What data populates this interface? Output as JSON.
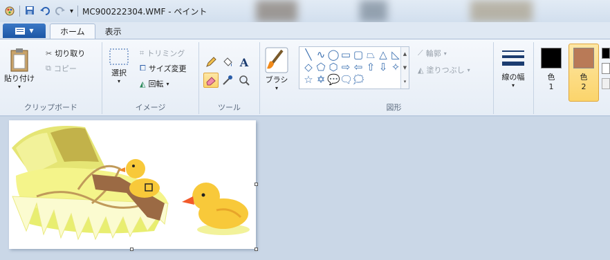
{
  "window": {
    "title": "MC900222304.WMF - ペイント"
  },
  "quick_access": {
    "icons": [
      "paint-app-icon",
      "save-icon",
      "undo-icon",
      "redo-icon",
      "customize-dropdown-icon"
    ]
  },
  "menu": {
    "file_label": "",
    "tabs": [
      {
        "label": "ホーム",
        "active": true
      },
      {
        "label": "表示",
        "active": false
      }
    ]
  },
  "ribbon": {
    "clipboard": {
      "group_label": "クリップボード",
      "paste_label": "貼り付け",
      "cut_label": "切り取り",
      "copy_label": "コピー"
    },
    "image": {
      "group_label": "イメージ",
      "select_label": "選択",
      "crop_label": "トリミング",
      "resize_label": "サイズ変更",
      "rotate_label": "回転"
    },
    "tools": {
      "group_label": "ツール",
      "items": [
        "pencil-icon",
        "fill-bucket-icon",
        "text-icon",
        "eraser-icon",
        "color-picker-icon",
        "magnifier-icon"
      ],
      "selected": "eraser-icon"
    },
    "brushes": {
      "label": "ブラシ"
    },
    "shapes": {
      "group_label": "図形",
      "glyphs": [
        "╲",
        "∿",
        "◯",
        "▭",
        "▢",
        "⏢",
        "△",
        "◺",
        "◇",
        "⬠",
        "⬡",
        "⇨",
        "⇦",
        "⇧",
        "⇩",
        "✧",
        "☆",
        "✡",
        "💬",
        "🗨",
        "🗯"
      ],
      "outline_label": "輪郭",
      "fill_label": "塗りつぶし"
    },
    "size": {
      "label": "線の幅"
    },
    "colors": {
      "color1_label": "色",
      "color1_num": "1",
      "color1_value": "#000000",
      "color2_label": "色",
      "color2_num": "2",
      "color2_value": "#b97a57"
    }
  },
  "colors": {
    "accent": "#1b56a5",
    "selected_tool": "#fbd46b",
    "workspace": "#cad7e7"
  }
}
